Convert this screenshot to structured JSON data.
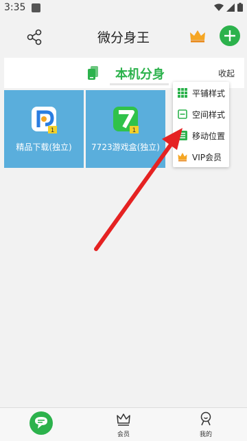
{
  "status_bar": {
    "time": "3:35"
  },
  "header": {
    "title": "微分身王"
  },
  "section": {
    "title": "本机分身",
    "collapse_label": "收起"
  },
  "apps": [
    {
      "label": "精品下载(独立)",
      "icon": "p-app-icon",
      "badge": "1"
    },
    {
      "label": "7723游戏盒(独立)",
      "icon": "seven-app-icon",
      "badge": "1"
    }
  ],
  "menu": {
    "items": [
      {
        "label": "平铺样式",
        "icon": "grid-icon"
      },
      {
        "label": "空间样式",
        "icon": "card-icon"
      },
      {
        "label": "移动位置",
        "icon": "list-icon"
      },
      {
        "label": "VIP会员",
        "icon": "crown-icon"
      }
    ]
  },
  "bottom_nav": {
    "items": [
      {
        "label": "",
        "icon": "chat-icon"
      },
      {
        "label": "会员",
        "icon": "crown-icon"
      },
      {
        "label": "我的",
        "icon": "person-icon"
      }
    ]
  },
  "colors": {
    "accent": "#2cb24c",
    "tile": "#5aaedc",
    "arrow": "#e52222",
    "crown": "#f5a623"
  }
}
